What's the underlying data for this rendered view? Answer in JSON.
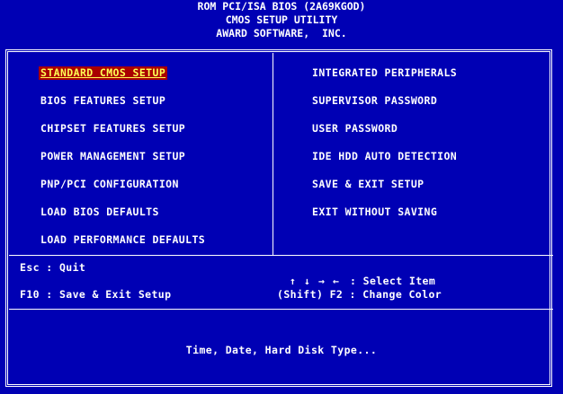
{
  "header": {
    "line1": "ROM PCI/ISA BIOS (2A69KGOD)",
    "line2": "CMOS SETUP UTILITY",
    "line3": "AWARD SOFTWARE,  INC."
  },
  "menu": {
    "left": [
      {
        "label": "STANDARD CMOS SETUP",
        "selected": true
      },
      {
        "label": "BIOS FEATURES SETUP"
      },
      {
        "label": "CHIPSET FEATURES SETUP"
      },
      {
        "label": "POWER MANAGEMENT SETUP"
      },
      {
        "label": "PNP/PCI CONFIGURATION"
      },
      {
        "label": "LOAD BIOS DEFAULTS"
      },
      {
        "label": "LOAD PERFORMANCE DEFAULTS"
      }
    ],
    "right": [
      {
        "label": "INTEGRATED PERIPHERALS"
      },
      {
        "label": "SUPERVISOR PASSWORD"
      },
      {
        "label": "USER PASSWORD"
      },
      {
        "label": "IDE HDD AUTO DETECTION"
      },
      {
        "label": "SAVE & EXIT SETUP"
      },
      {
        "label": "EXIT WITHOUT SAVING"
      }
    ]
  },
  "keys": {
    "esc": "Esc : Quit",
    "f10": "F10 : Save & Exit Setup",
    "arrows": [
      "↑",
      "↓",
      "→",
      "←"
    ],
    "select": ": Select Item",
    "color": "(Shift) F2 : Change Color"
  },
  "status": "Time, Date, Hard Disk Type...",
  "colors": {
    "background": "#0000b4",
    "text": "#ffffff",
    "highlight_bg": "#a90000",
    "highlight_text": "#ffff55"
  }
}
